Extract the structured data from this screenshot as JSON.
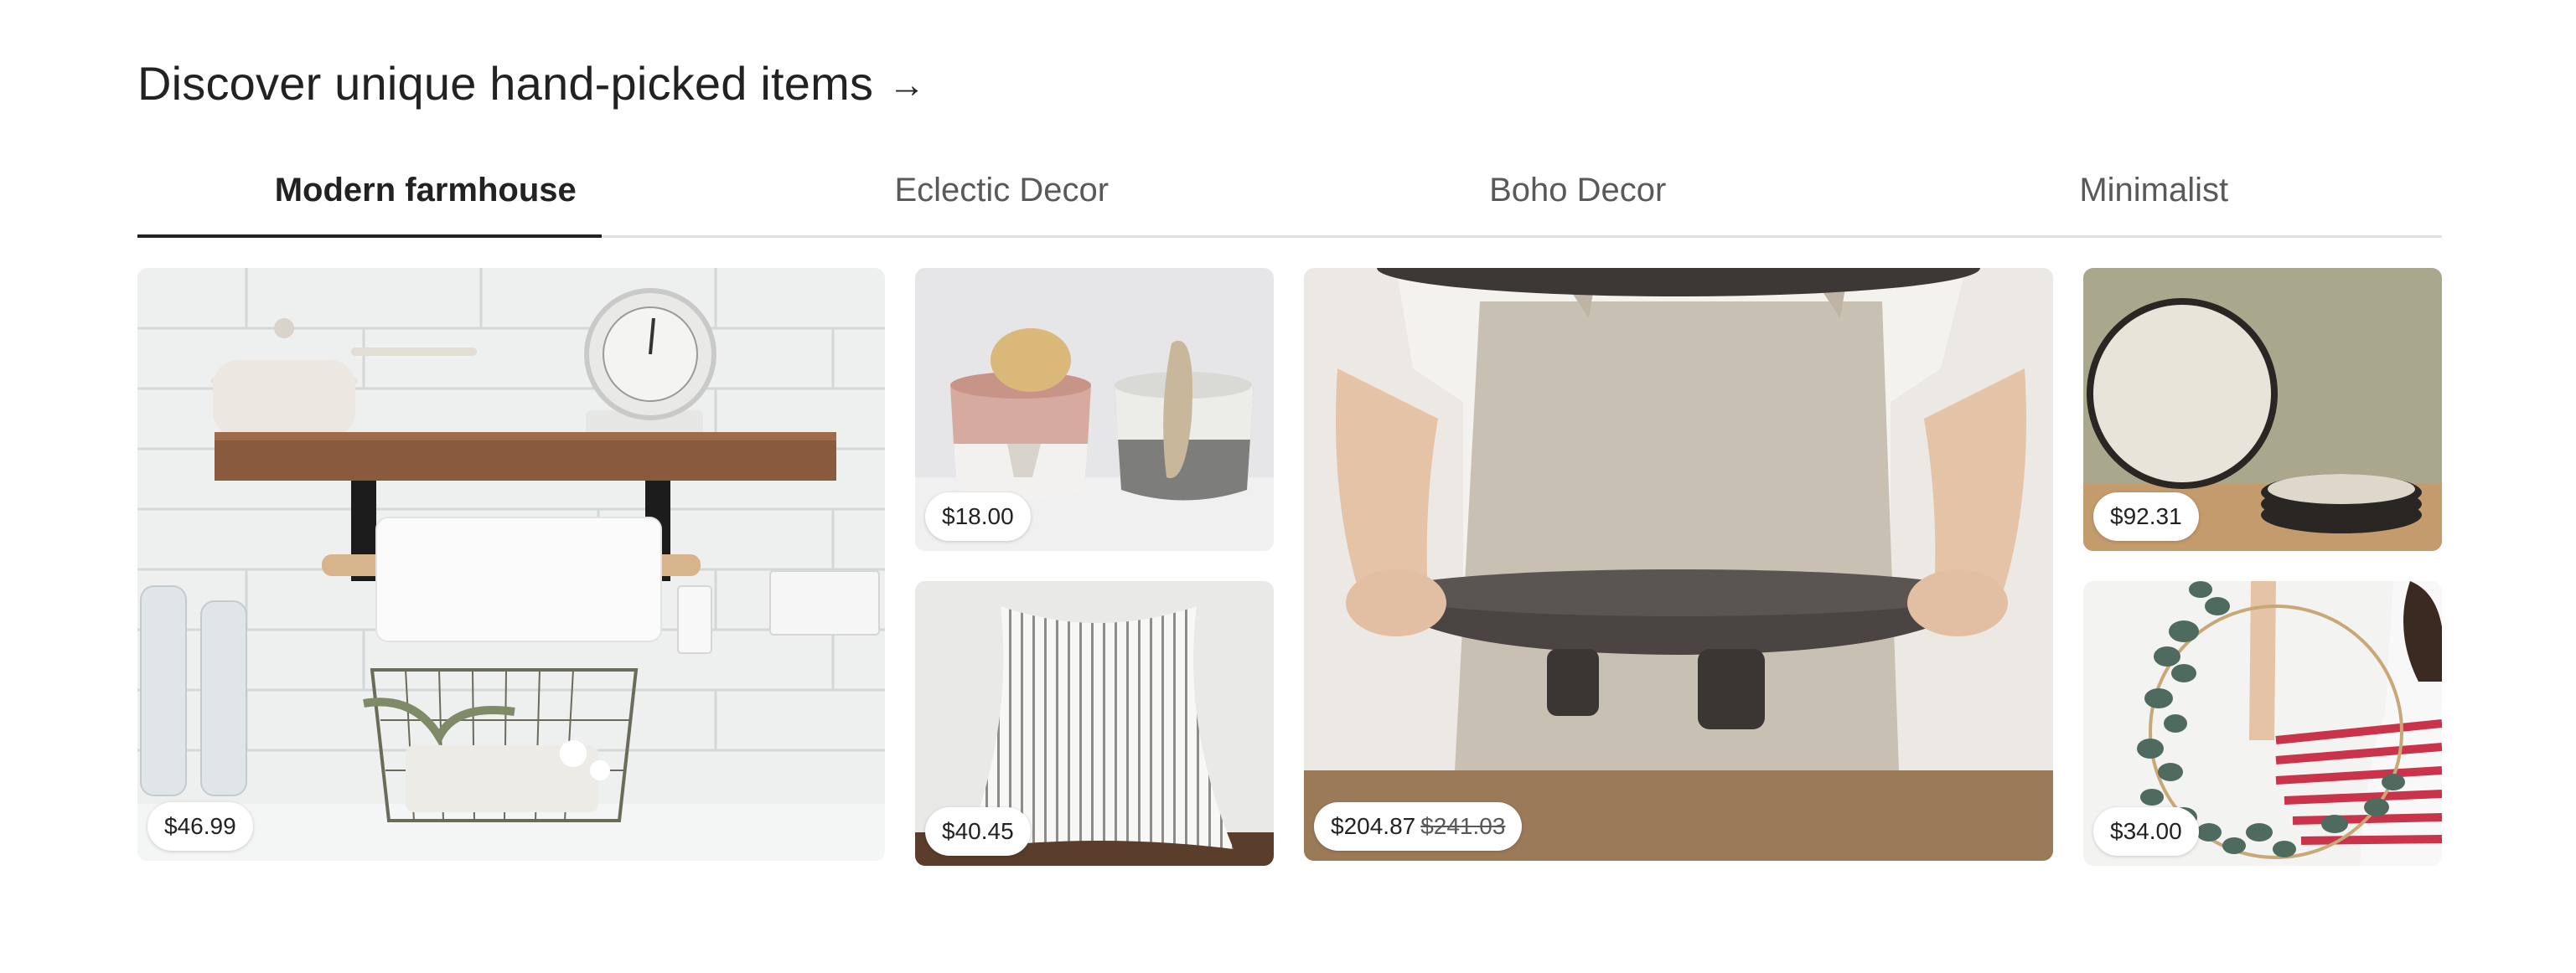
{
  "heading": {
    "title": "Discover unique hand-picked items",
    "arrow": "→"
  },
  "tabs": [
    {
      "label": "Modern farmhouse",
      "active": true
    },
    {
      "label": "Eclectic Decor",
      "active": false
    },
    {
      "label": "Boho Decor",
      "active": false
    },
    {
      "label": "Minimalist",
      "active": false
    }
  ],
  "items": [
    {
      "name": "kitchen-shelf",
      "price": "$46.99"
    },
    {
      "name": "sponge-holder",
      "price": "$18.00"
    },
    {
      "name": "striped-pillow",
      "price": "$40.45"
    },
    {
      "name": "ceramic-tray",
      "price": "$204.87",
      "original_price": "$241.03"
    },
    {
      "name": "ceramic-plates",
      "price": "$92.31"
    },
    {
      "name": "eucalyptus-wreath",
      "price": "$34.00"
    }
  ]
}
